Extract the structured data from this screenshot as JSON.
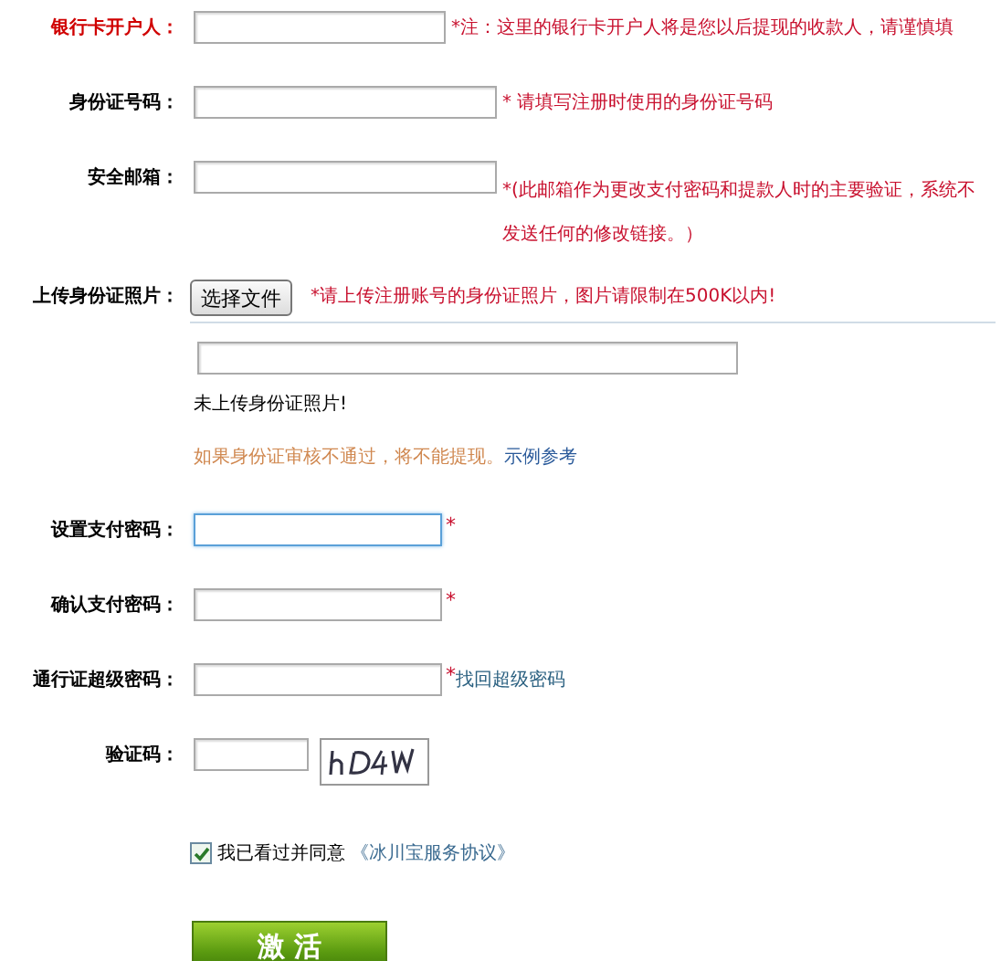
{
  "fields": [
    {
      "kind": "text",
      "label": "银行卡开户人：",
      "highlighted": true,
      "note": "*注：这里的银行卡开户人将是您以后提现的收款人，请谨慎填"
    },
    {
      "kind": "text",
      "label": "身份证号码：",
      "highlighted": false,
      "note": "* 请填写注册时使用的身份证号码"
    },
    {
      "kind": "text",
      "label": "安全邮箱：",
      "highlighted": false,
      "note": "*(此邮箱作为更改支付密码和提款人时的主要验证，系统不",
      "note_continued": "发送任何的修改链接。）"
    },
    {
      "kind": "upload",
      "label": "上传身份证照片：",
      "button": "选择文件",
      "note": "*请上传注册账号的身份证照片，图片请限制在500K以内!",
      "status": "未上传身份证照片!",
      "warning": "如果身份证审核不通过，将不能提现。",
      "link": "示例参考"
    },
    {
      "kind": "password",
      "label": "设置支付密码：",
      "focused": true,
      "mark": "*"
    },
    {
      "kind": "password",
      "label": "确认支付密码：",
      "focused": false,
      "mark": "*"
    },
    {
      "kind": "password",
      "label": "通行证超级密码：",
      "focused": false,
      "mark": "*",
      "link": "找回超级密码"
    },
    {
      "kind": "captcha",
      "label": "验证码："
    }
  ],
  "agreement": {
    "checked": true,
    "text": "我已看过并同意",
    "link": "《冰川宝服务协议》"
  },
  "submit": "激 活"
}
